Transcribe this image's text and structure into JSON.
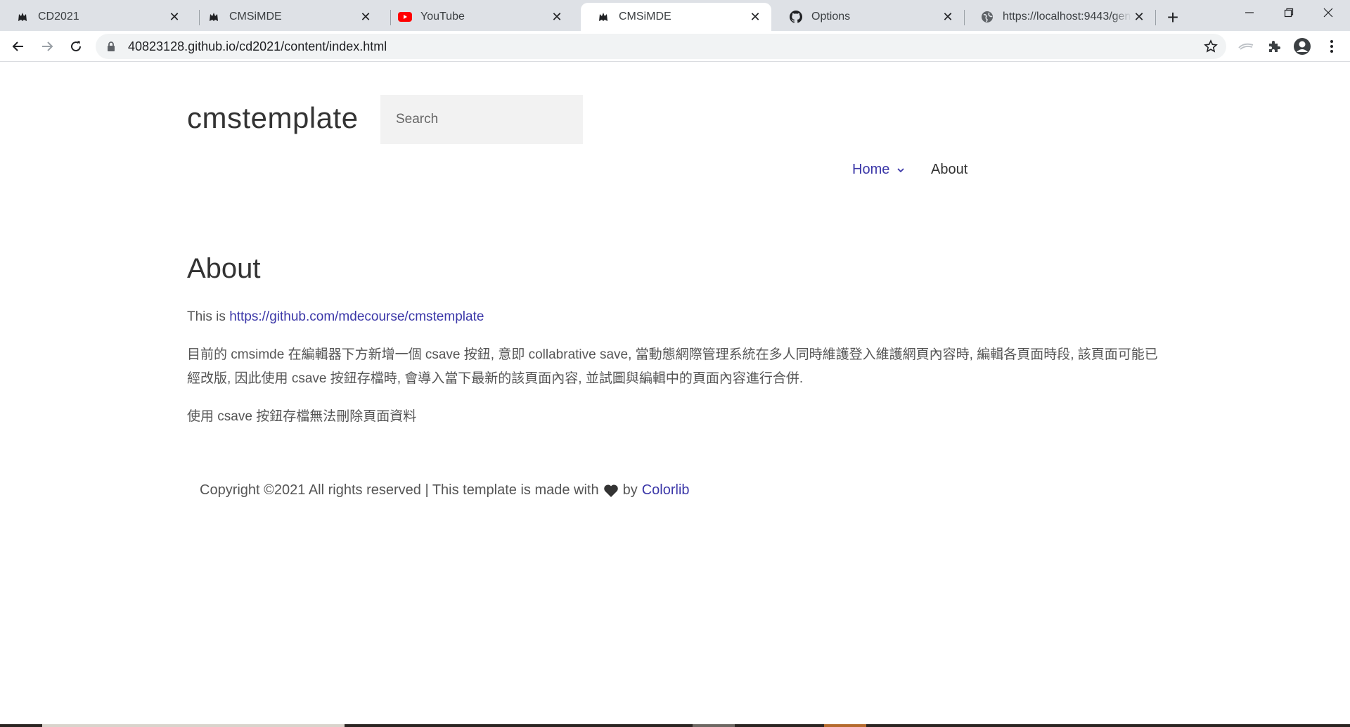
{
  "browser": {
    "tabs": [
      {
        "title": "CD2021",
        "icon": "cat-icon",
        "active": false
      },
      {
        "title": "CMSiMDE",
        "icon": "cat-icon",
        "active": false
      },
      {
        "title": "YouTube",
        "icon": "youtube-icon",
        "active": false
      },
      {
        "title": "CMSiMDE",
        "icon": "cat-icon",
        "active": true
      },
      {
        "title": "Options",
        "icon": "github-icon",
        "active": false
      },
      {
        "title": "https://localhost:9443/gen",
        "icon": "globe-icon",
        "active": false
      }
    ],
    "close_glyph": "✕",
    "new_tab_glyph": "+",
    "url": "40823128.github.io/cd2021/content/index.html"
  },
  "site": {
    "title": "cmstemplate",
    "search_placeholder": "Search",
    "nav": {
      "home": "Home",
      "about": "About"
    }
  },
  "content": {
    "heading": "About",
    "p1_prefix": "This is ",
    "p1_link": "https://github.com/mdecourse/cmstemplate",
    "p2": "目前的 cmsimde 在編輯器下方新增一個 csave 按鈕, 意即 collabrative save, 當動態網際管理系統在多人同時維護登入維護網頁內容時, 編輯各頁面時段, 該頁面可能已經改版, 因此使用 csave 按鈕存檔時, 會導入當下最新的該頁面內容, 並試圖與編輯中的頁面內容進行合併.",
    "p3": "使用 csave 按鈕存檔無法刪除頁面資料"
  },
  "footer": {
    "prefix": "Copyright ©2021 All rights reserved | This template is made with",
    "by": "by",
    "link": "Colorlib"
  },
  "colors": {
    "link": "#3b37a8",
    "tabstrip": "#dee1e6",
    "youtube_red": "#ff0000"
  }
}
